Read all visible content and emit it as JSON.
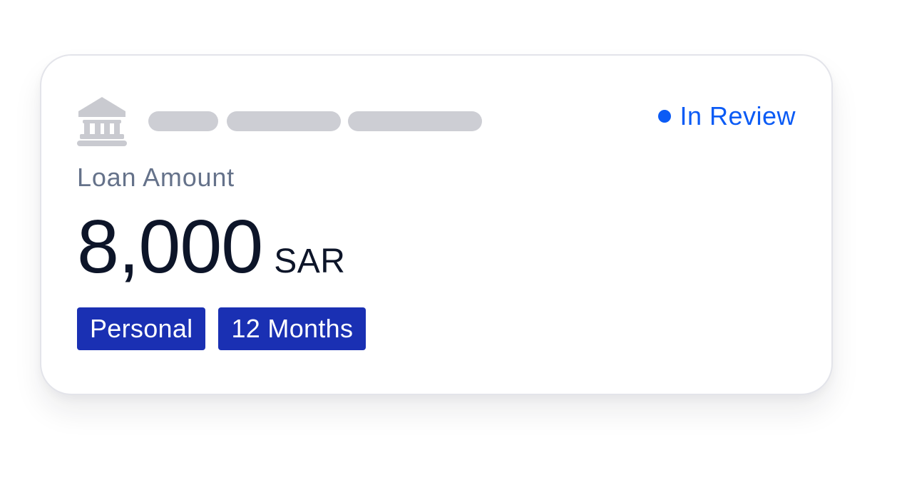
{
  "card": {
    "icon": "bank-icon",
    "status": {
      "label": "In Review",
      "color": "#0b5bf5"
    },
    "loan_label": "Loan Amount",
    "amount": {
      "value": "8,000",
      "currency": "SAR"
    },
    "tags": [
      {
        "label": "Personal"
      },
      {
        "label": "12 Months"
      }
    ],
    "colors": {
      "tag_bg": "#1a30b3",
      "amount_text": "#0d1529",
      "label_text": "#65728a",
      "skeleton": "#cdced4"
    }
  }
}
